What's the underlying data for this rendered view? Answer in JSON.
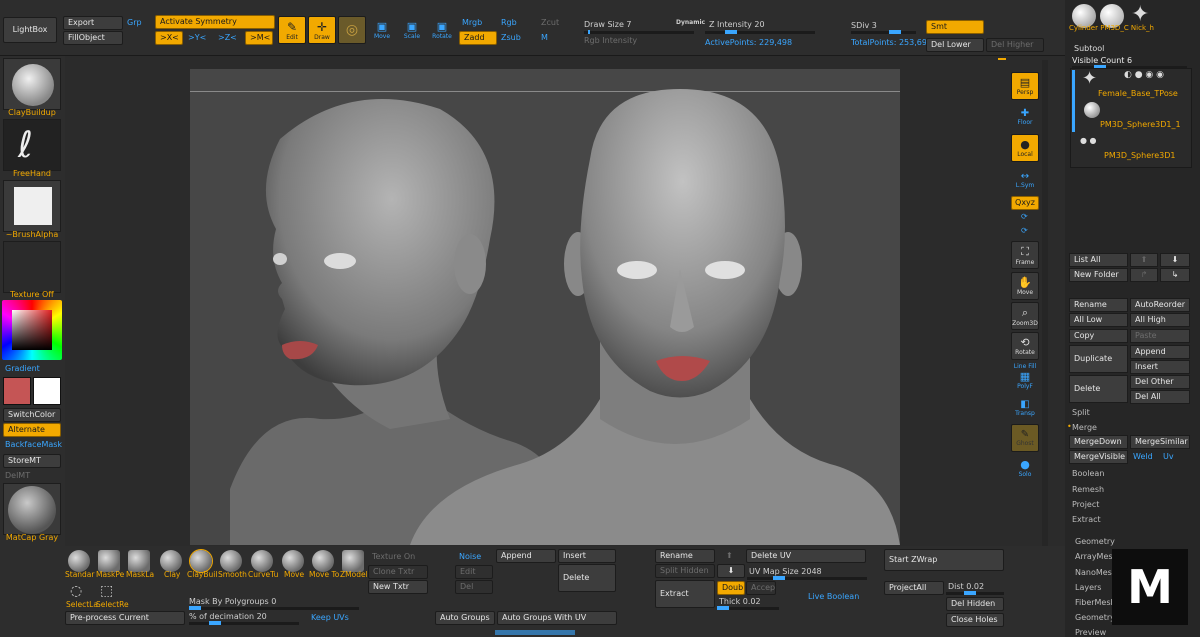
{
  "top": {
    "lightbox": "LightBox",
    "export": "Export",
    "fillobject": "FillObject",
    "grp": "Grp",
    "activate_symmetry": "Activate Symmetry",
    "sym_x": ">X<",
    "sym_y": ">Y<",
    "sym_z": ">Z<",
    "sym_m": ">M<",
    "edit": "Edit",
    "draw": "Draw",
    "move": "Move",
    "scale": "Scale",
    "rotate": "Rotate",
    "mrgb": "Mrgb",
    "rgb": "Rgb",
    "zcut": "Zcut",
    "zadd": "Zadd",
    "zsub": "Zsub",
    "m": "M",
    "draw_size": "Draw Size 7",
    "dynamic": "Dynamic",
    "rgb_intensity": "Rgb Intensity",
    "z_intensity": "Z Intensity 20",
    "active_points": "ActivePoints: 229,498",
    "sdiv": "SDiv 3",
    "total_points": "TotalPoints: 253,696",
    "smt": "Smt",
    "del_lower": "Del Lower",
    "del_higher": "Del Higher"
  },
  "left": {
    "brush": "ClayBuildup",
    "stroke": "FreeHand",
    "alpha": "~BrushAlpha",
    "texture": "Texture Off",
    "gradient": "Gradient",
    "switchcolor": "SwitchColor",
    "alternate": "Alternate",
    "backfacemask": "BackfaceMask",
    "storemt": "StoreMT",
    "delmt": "DelMT",
    "material": "MatCap Gray",
    "main_color": "#c55555",
    "secondary_color": "#ffffff"
  },
  "right_tools": {
    "persp": "Persp",
    "floor": "Floor",
    "local": "Local",
    "lsym": "L.Sym",
    "xyz": "Qxyz",
    "frame": "Frame",
    "move": "Move",
    "zoom3d": "Zoom3D",
    "rotate": "Rotate",
    "linefill": "Line Fill",
    "polyf": "PolyF",
    "transp": "Transp",
    "ghost": "Ghost",
    "solo": "Solo"
  },
  "subtool": {
    "header_names": "Cylinder PM3D_C Nick_h",
    "title": "Subtool",
    "visible_count": "Visible Count 6",
    "items": [
      "Female_Base_TPose",
      "PM3D_Sphere3D1_1",
      "PM3D_Sphere3D1"
    ],
    "list_all": "List All",
    "new_folder": "New Folder",
    "rename": "Rename",
    "autoreorder": "AutoReorder",
    "all_low": "All Low",
    "all_high": "All High",
    "copy": "Copy",
    "paste": "Paste",
    "duplicate": "Duplicate",
    "append": "Append",
    "insert": "Insert",
    "delete": "Delete",
    "del_other": "Del Other",
    "del_all": "Del All",
    "split": "Split",
    "merge": "Merge",
    "mergedown": "MergeDown",
    "mergesimilar": "MergeSimilar",
    "mergevisible": "MergeVisible",
    "weld": "Weld",
    "uv": "Uv",
    "boolean": "Boolean",
    "remesh": "Remesh",
    "project": "Project",
    "extract": "Extract",
    "geometry": "Geometry",
    "arraymesh": "ArrayMesh",
    "nanomesh": "NanoMesh",
    "layers": "Layers",
    "fibermesh": "FiberMesh",
    "geometry_hd": "Geometry",
    "preview": "Preview"
  },
  "bottom": {
    "brushes": [
      "Standar",
      "MaskPe",
      "MaskLa",
      "Clay",
      "ClayBuil",
      "Smooth",
      "CurveTu",
      "Move",
      "Move To",
      "ZModele"
    ],
    "selectlasso": "SelectLa",
    "selectrect": "SelectRe",
    "texture_on": "Texture On",
    "clone_txtr": "Clone Txtr",
    "new_txtr": "New Txtr",
    "noise": "Noise",
    "edit": "Edit",
    "del": "Del",
    "append": "Append",
    "insert": "Insert",
    "delete": "Delete",
    "mask_by_polygroups": "Mask By Polygroups 0",
    "preprocess": "Pre-process Current",
    "decimation": "% of decimation 20",
    "keep_uvs": "Keep UVs",
    "auto_groups": "Auto Groups",
    "auto_groups_uv": "Auto Groups With UV",
    "rename": "Rename",
    "split_hidden": "Split Hidden",
    "extract": "Extract",
    "double": "Double",
    "accept": "Accept",
    "thick": "Thick 0.02",
    "delete_uv": "Delete UV",
    "uv_map_size": "UV Map Size 2048",
    "live_boolean": "Live Boolean",
    "start_zwrap": "Start ZWrap",
    "projectall": "ProjectAll",
    "dist": "Dist 0.02",
    "del_hidden": "Del Hidden",
    "close_holes": "Close Holes"
  }
}
